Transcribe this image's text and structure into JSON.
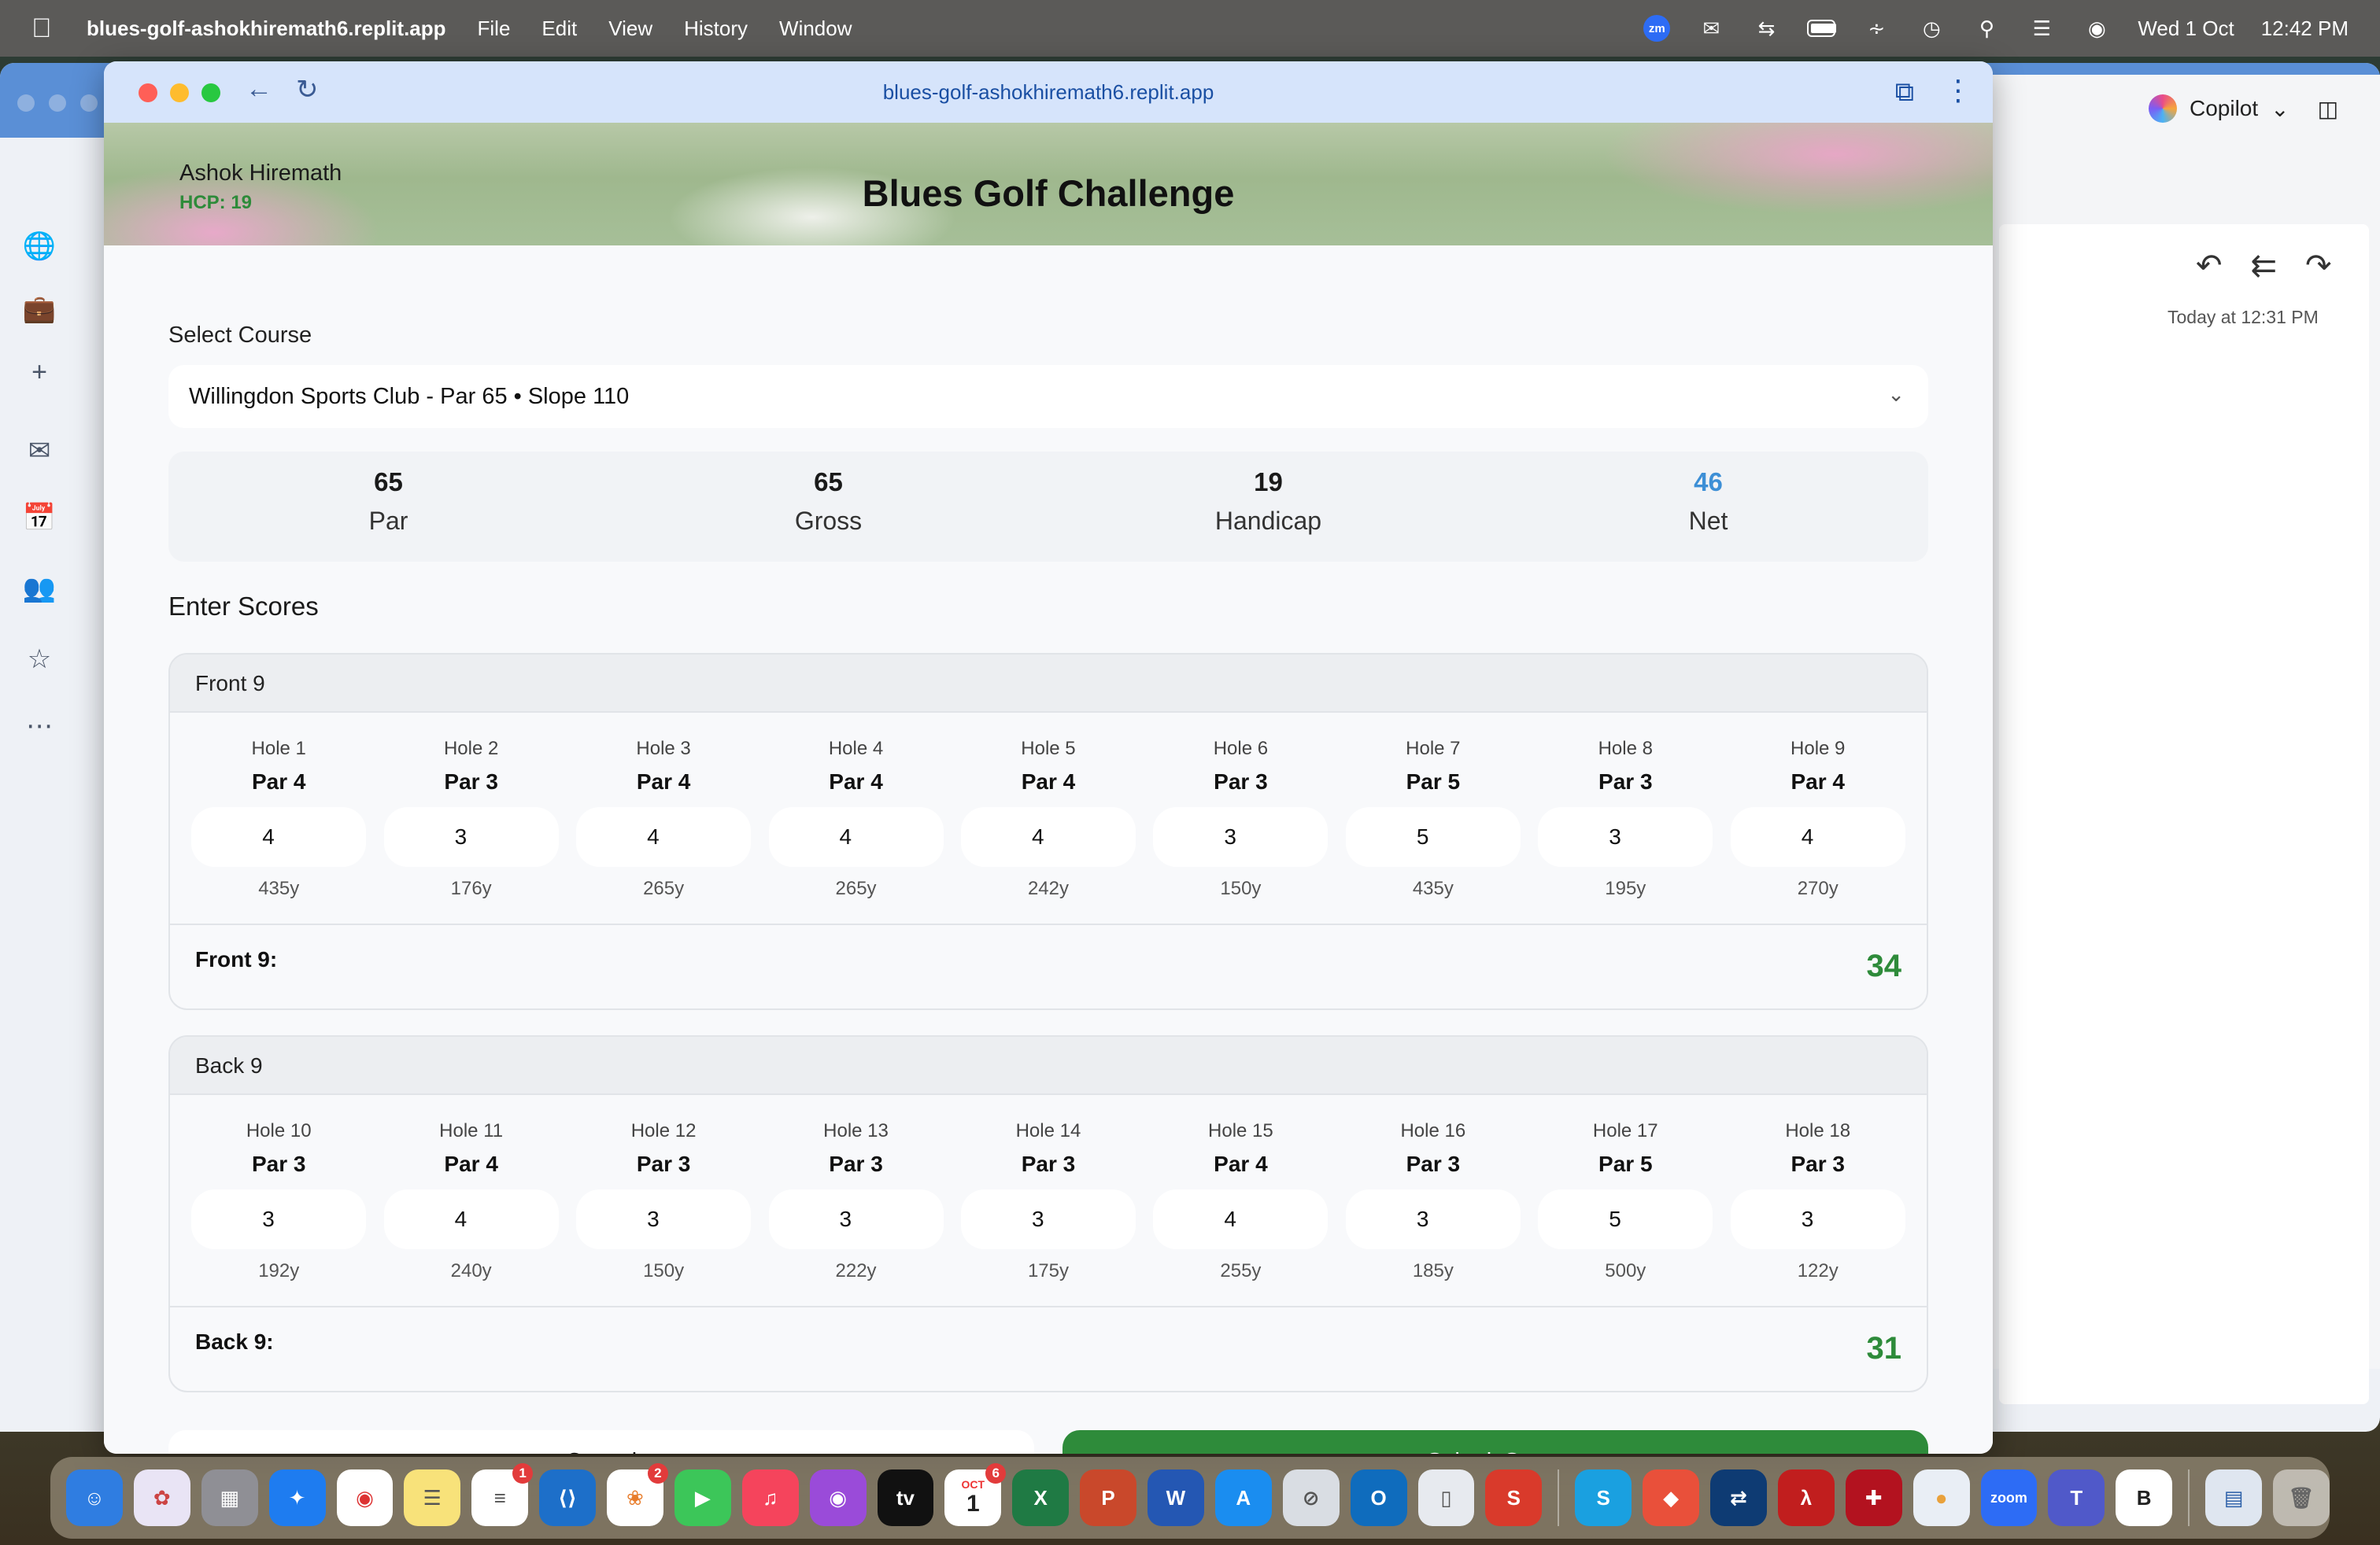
{
  "menubar": {
    "app_name": "blues-golf-ashokhiremath6.replit.app",
    "menus": [
      "File",
      "Edit",
      "View",
      "History",
      "Window"
    ],
    "zoom_icon_label": "zm",
    "date": "Wed 1 Oct",
    "time": "12:42 PM"
  },
  "browser": {
    "url": "blues-golf-ashokhiremath6.replit.app"
  },
  "header": {
    "user_name": "Ashok Hiremath",
    "handicap_label": "HCP: 19",
    "title": "Blues Golf Challenge"
  },
  "course": {
    "label": "Select Course",
    "selected": "Willingdon Sports Club - Par 65 • Slope 110"
  },
  "summary": {
    "par": {
      "value": "65",
      "label": "Par"
    },
    "gross": {
      "value": "65",
      "label": "Gross"
    },
    "handicap": {
      "value": "19",
      "label": "Handicap"
    },
    "net": {
      "value": "46",
      "label": "Net"
    }
  },
  "scores": {
    "title": "Enter Scores",
    "front": {
      "title": "Front 9",
      "total_label": "Front 9:",
      "total": "34",
      "holes": [
        {
          "name": "Hole 1",
          "par": "Par 4",
          "score": "4",
          "yards": "435y"
        },
        {
          "name": "Hole 2",
          "par": "Par 3",
          "score": "3",
          "yards": "176y"
        },
        {
          "name": "Hole 3",
          "par": "Par 4",
          "score": "4",
          "yards": "265y"
        },
        {
          "name": "Hole 4",
          "par": "Par 4",
          "score": "4",
          "yards": "265y"
        },
        {
          "name": "Hole 5",
          "par": "Par 4",
          "score": "4",
          "yards": "242y"
        },
        {
          "name": "Hole 6",
          "par": "Par 3",
          "score": "3",
          "yards": "150y"
        },
        {
          "name": "Hole 7",
          "par": "Par 5",
          "score": "5",
          "yards": "435y"
        },
        {
          "name": "Hole 8",
          "par": "Par 3",
          "score": "3",
          "yards": "195y"
        },
        {
          "name": "Hole 9",
          "par": "Par 4",
          "score": "4",
          "yards": "270y"
        }
      ]
    },
    "back": {
      "title": "Back 9",
      "total_label": "Back 9:",
      "total": "31",
      "holes": [
        {
          "name": "Hole 10",
          "par": "Par 3",
          "score": "3",
          "yards": "192y"
        },
        {
          "name": "Hole 11",
          "par": "Par 4",
          "score": "4",
          "yards": "240y"
        },
        {
          "name": "Hole 12",
          "par": "Par 3",
          "score": "3",
          "yards": "150y"
        },
        {
          "name": "Hole 13",
          "par": "Par 3",
          "score": "3",
          "yards": "222y"
        },
        {
          "name": "Hole 14",
          "par": "Par 3",
          "score": "3",
          "yards": "175y"
        },
        {
          "name": "Hole 15",
          "par": "Par 4",
          "score": "4",
          "yards": "255y"
        },
        {
          "name": "Hole 16",
          "par": "Par 3",
          "score": "3",
          "yards": "185y"
        },
        {
          "name": "Hole 17",
          "par": "Par 5",
          "score": "5",
          "yards": "500y"
        },
        {
          "name": "Hole 18",
          "par": "Par 3",
          "score": "3",
          "yards": "122y"
        }
      ]
    }
  },
  "actions": {
    "cancel": "Cancel",
    "submit": "Submit Score"
  },
  "outlook": {
    "copilot_label": "Copilot",
    "mail_time": "Today at 12:31 PM"
  },
  "dock": {
    "reminders_badge": "1",
    "photos_badge": "2",
    "calendar_badge": "6",
    "calendar_month": "OCT",
    "calendar_day": "1",
    "zoom_label": "zoom",
    "b_label": "B"
  },
  "colors": {
    "accent_green": "#2e8b3a",
    "net_blue": "#3d8fd6",
    "browser_toolbar": "#d6e4fb"
  }
}
